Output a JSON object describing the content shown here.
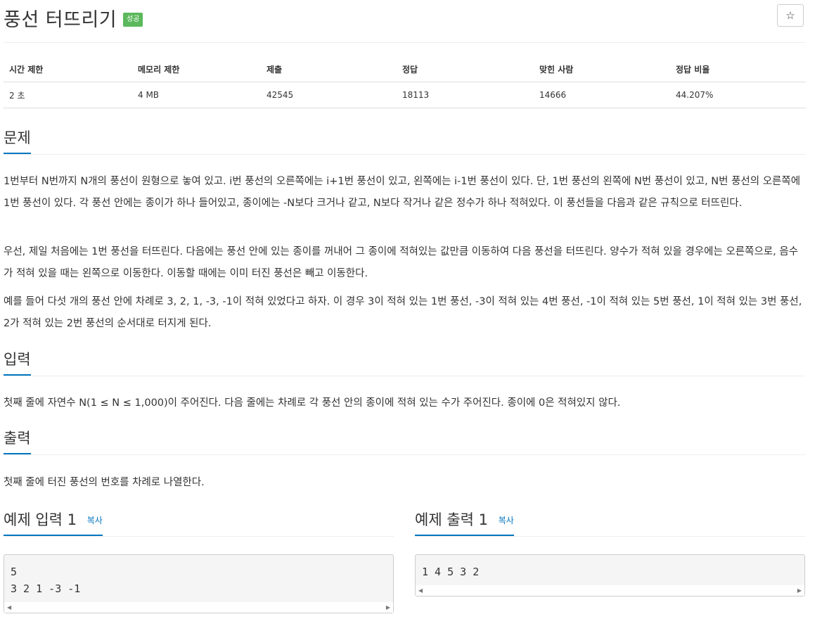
{
  "header": {
    "title": "풍선 터뜨리기",
    "badge": "성공",
    "star_icon": "☆"
  },
  "info": {
    "headers": [
      "시간 제한",
      "메모리 제한",
      "제출",
      "정답",
      "맞힌 사람",
      "정답 비율"
    ],
    "values": [
      "2 초",
      "4 MB",
      "42545",
      "18113",
      "14666",
      "44.207%"
    ]
  },
  "problem": {
    "heading": "문제",
    "paragraphs": [
      "1번부터 N번까지 N개의 풍선이 원형으로 놓여 있고. i번 풍선의 오른쪽에는 i+1번 풍선이 있고, 왼쪽에는 i-1번 풍선이 있다. 단, 1번 풍선의 왼쪽에 N번 풍선이 있고, N번 풍선의 오른쪽에 1번 풍선이 있다. 각 풍선 안에는 종이가 하나 들어있고, 종이에는 -N보다 크거나 같고, N보다 작거나 같은 정수가 하나 적혀있다. 이 풍선들을 다음과 같은 규칙으로 터뜨린다.",
      "우선, 제일 처음에는 1번 풍선을 터뜨린다. 다음에는 풍선 안에 있는 종이를 꺼내어 그 종이에 적혀있는 값만큼 이동하여 다음 풍선을 터뜨린다. 양수가 적혀 있을 경우에는 오른쪽으로, 음수가 적혀 있을 때는 왼쪽으로 이동한다. 이동할 때에는 이미 터진 풍선은 빼고 이동한다.",
      "예를 들어 다섯 개의 풍선 안에 차례로 3, 2, 1, -3, -1이 적혀 있었다고 하자. 이 경우 3이 적혀 있는 1번 풍선, -3이 적혀 있는 4번 풍선, -1이 적혀 있는 5번 풍선, 1이 적혀 있는 3번 풍선, 2가 적혀 있는 2번 풍선의 순서대로 터지게 된다."
    ]
  },
  "input": {
    "heading": "입력",
    "text": "첫째 줄에 자연수 N(1 ≤ N ≤ 1,000)이 주어진다. 다음 줄에는 차례로 각 풍선 안의 종이에 적혀 있는 수가 주어진다. 종이에 0은 적혀있지 않다."
  },
  "output": {
    "heading": "출력",
    "text": "첫째 줄에 터진 풍선의 번호를 차례로 나열한다."
  },
  "sample_input": {
    "heading": "예제 입력 1",
    "copy_label": "복사",
    "content": "5\n3 2 1 -3 -1"
  },
  "sample_output": {
    "heading": "예제 출력 1",
    "copy_label": "복사",
    "content": "1 4 5 3 2"
  },
  "scroll": {
    "left_arrow": "◀",
    "right_arrow": "▶"
  }
}
